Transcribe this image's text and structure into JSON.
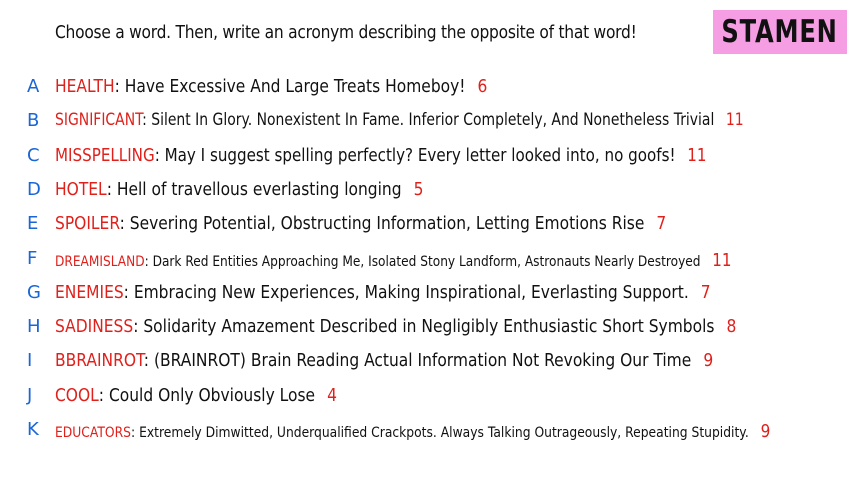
{
  "prompt": "Choose a word. Then, write an acronym describing the opposite of that word!",
  "logo": "STAMEN",
  "colors": {
    "letter": "#1a66d6",
    "word": "#e0201b",
    "count": "#e0201b",
    "logo_bg": "#f59ee4"
  },
  "items": [
    {
      "letter": "A",
      "word": "HEALTH",
      "acronym": "Have Excessive And Large Treats Homeboy!",
      "count": "6"
    },
    {
      "letter": "B",
      "word": "SIGNIFICANT",
      "acronym": "Silent In Glory. Nonexistent In Fame. Inferior Completely, And Nonetheless Trivial",
      "count": "11"
    },
    {
      "letter": "C",
      "word": "MISSPELLING",
      "acronym": "May I suggest spelling perfectly? Every letter looked into, no goofs!",
      "count": "11"
    },
    {
      "letter": "D",
      "word": "HOTEL",
      "acronym": "Hell of travellous everlasting longing",
      "count": "5"
    },
    {
      "letter": "E",
      "word": "SPOILER",
      "acronym": "Severing Potential, Obstructing Information, Letting Emotions Rise",
      "count": "7"
    },
    {
      "letter": "F",
      "word": "DREAMISLAND",
      "acronym": "Dark Red Entities Approaching Me, Isolated Stony Landform, Astronauts Nearly Destroyed",
      "count": "11"
    },
    {
      "letter": "G",
      "word": "ENEMIES",
      "acronym": "Embracing New Experiences, Making Inspirational, Everlasting Support.",
      "count": "7"
    },
    {
      "letter": "H",
      "word": "SADINESS",
      "acronym": "Solidarity Amazement Described in Negligibly Enthusiastic Short Symbols",
      "count": "8"
    },
    {
      "letter": "I",
      "word": "BBRAINROT",
      "acronym": "(BRAINROT) Brain Reading Actual Information Not Revoking Our Time",
      "count": "9"
    },
    {
      "letter": "J",
      "word": "COOL",
      "acronym": "Could Only Obviously Lose",
      "count": "4"
    },
    {
      "letter": "K",
      "word": "EDUCATORS",
      "acronym": "Extremely Dimwitted, Underqualified Crackpots. Always Talking Outrageously, Repeating Stupidity.",
      "count": "9"
    }
  ]
}
